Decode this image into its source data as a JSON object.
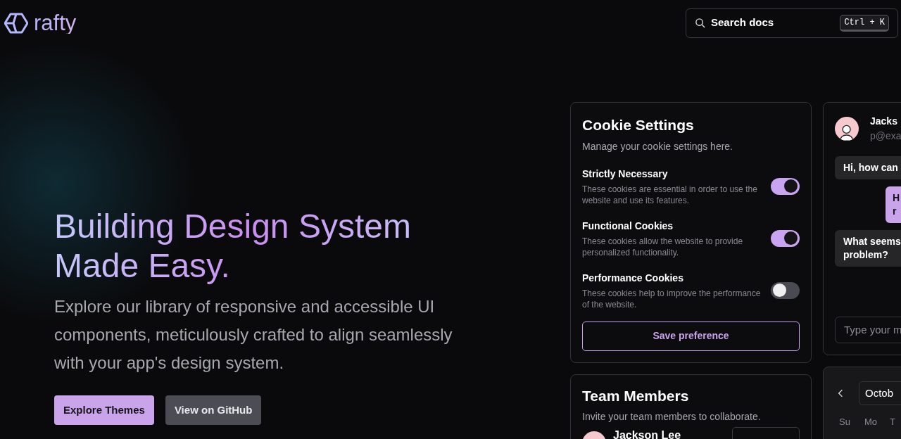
{
  "header": {
    "logo_text": "rafty",
    "search": {
      "label": "Search docs",
      "shortcut": "Ctrl + K"
    }
  },
  "hero": {
    "title_parts": [
      "Building Design System",
      "Made Easy."
    ],
    "subtitle": "Explore our library of responsive and accessible UI components, meticulously crafted to align seamlessly with your app's design system.",
    "buttons": [
      {
        "label": "Explore Themes",
        "kind": "primary"
      },
      {
        "label": "View on GitHub",
        "kind": "secondary"
      }
    ]
  },
  "cookie_settings": {
    "title": "Cookie Settings",
    "subtitle": "Manage your cookie settings here.",
    "items": [
      {
        "name": "Strictly Necessary",
        "description": "These cookies are essential in order to use the website and use its features.",
        "on": true
      },
      {
        "name": "Functional Cookies",
        "description": "These cookies allow the website to provide personalized functionality.",
        "on": true
      },
      {
        "name": "Performance Cookies",
        "description": "These cookies help to improve the performance of the website.",
        "on": false
      }
    ],
    "button": "Save preference"
  },
  "chat": {
    "name": "Jacks",
    "email": "p@exa",
    "messages": [
      {
        "kind": "received",
        "lines": [
          "Hi, how can"
        ]
      },
      {
        "kind": "sent",
        "lines": [
          "H",
          "r"
        ]
      },
      {
        "kind": "received",
        "lines": [
          "What seems",
          "problem?"
        ]
      }
    ],
    "placeholder": "Type your m"
  },
  "team": {
    "title": "Team Members",
    "subtitle": "Invite your team members to collaborate.",
    "members": [
      {
        "name": "Jackson Lee"
      }
    ]
  },
  "calendar": {
    "month": "Octob",
    "weekdays": [
      "Su",
      "Mo",
      "T"
    ]
  }
}
